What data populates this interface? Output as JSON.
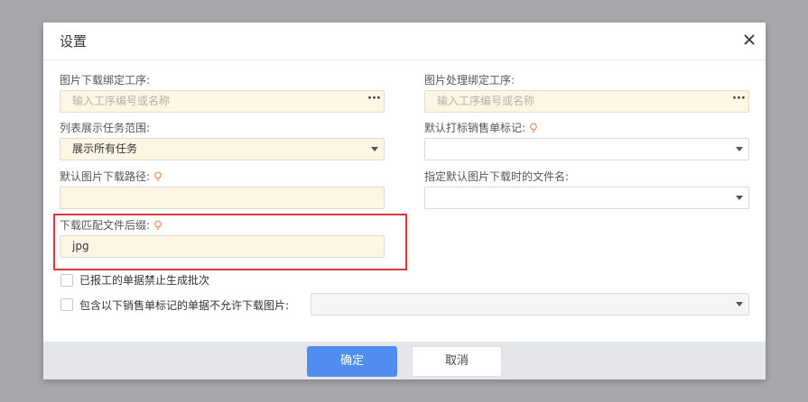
{
  "dialog": {
    "title": "设置"
  },
  "fields": {
    "image_download_process": {
      "label": "图片下载绑定工序:",
      "placeholder": "输入工序编号或名称"
    },
    "image_processing_process": {
      "label": "图片处理绑定工序:",
      "placeholder": "输入工序编号或名称"
    },
    "list_task_scope": {
      "label": "列表展示任务范围:",
      "value": "展示所有任务"
    },
    "default_sales_mark": {
      "label": "默认打标销售单标记:",
      "value": ""
    },
    "default_download_path": {
      "label": "默认图片下载路径:",
      "value": ""
    },
    "default_file_name": {
      "label": "指定默认图片下载时的文件名:",
      "value": ""
    },
    "download_suffix": {
      "label": "下载匹配文件后缀:",
      "value": "jpg"
    }
  },
  "checkboxes": {
    "reported_no_batch": {
      "label": "已报工的单据禁止生成批次",
      "checked": false
    },
    "sales_mark_no_download": {
      "label": "包含以下销售单标记的单据不允许下载图片:",
      "checked": false,
      "select_value": ""
    }
  },
  "footer": {
    "ok_label": "确定",
    "cancel_label": "取消"
  },
  "icons": {
    "close": "close-icon",
    "tip": "lightbulb-icon",
    "more": "more-dots-icon",
    "dropdown": "chevron-down-icon"
  },
  "colors": {
    "primary": "#4f8ef0",
    "highlight": "#d9363e",
    "field_bg": "#fdf6e4",
    "tip": "#f08a5d"
  }
}
